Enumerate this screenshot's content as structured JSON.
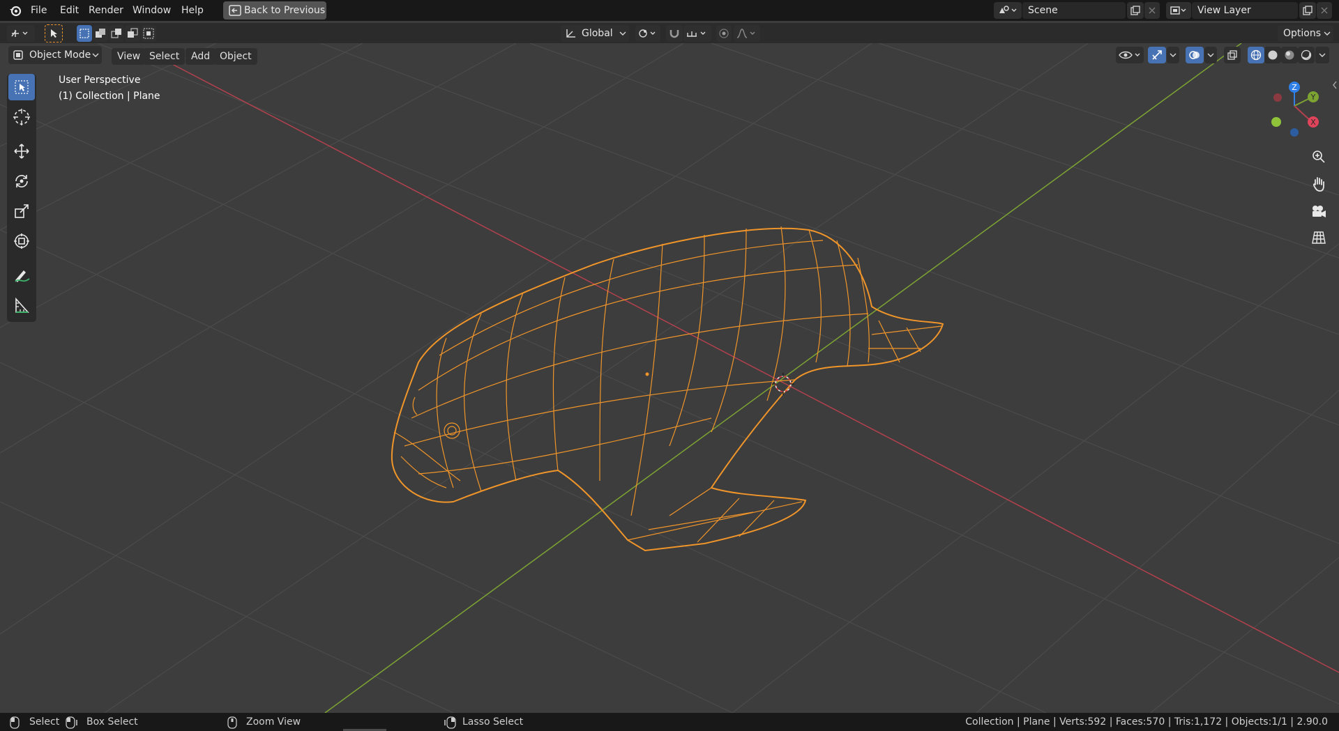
{
  "topbar": {
    "menus": [
      "File",
      "Edit",
      "Render",
      "Window",
      "Help"
    ],
    "back_button": "Back to Previous",
    "scene_value": "Scene",
    "view_layer_value": "View Layer"
  },
  "tool_header": {
    "orientation": "Global",
    "options": "Options"
  },
  "viewport_header": {
    "mode": "Object Mode",
    "menus": [
      "View",
      "Select",
      "Add",
      "Object"
    ]
  },
  "overlay": {
    "perspective": "User Perspective",
    "collection": "(1) Collection | Plane"
  },
  "gizmo": {
    "z": "Z",
    "y": "Y",
    "x": "X"
  },
  "statusbar": {
    "select": "Select",
    "box_select": "Box Select",
    "zoom_view": "Zoom View",
    "lasso_select": "Lasso Select",
    "stats": "Collection | Plane | Verts:592 | Faces:570 | Tris:1,172 | Objects:1/1 | 2.90.0"
  },
  "colors": {
    "accent": "#4772b3",
    "selection": "#f0952a",
    "x_axis": "#b3414d",
    "y_axis": "#7da433",
    "z_axis": "#2f7fe6"
  },
  "icons": {
    "app": "blender-logo-icon",
    "tools": [
      "select-box-icon",
      "cursor-icon",
      "move-icon",
      "rotate-icon",
      "scale-icon",
      "transform-icon",
      "annotate-icon",
      "measure-icon"
    ],
    "nav": [
      "zoom-icon",
      "pan-hand-icon",
      "camera-icon",
      "grid-ortho-icon"
    ]
  }
}
